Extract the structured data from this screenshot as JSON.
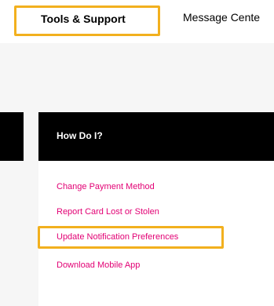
{
  "topbar": {
    "tabs": [
      {
        "label": "Tools & Support",
        "active": true
      },
      {
        "label": "Message Cente",
        "active": false
      }
    ],
    "highlight_color": "#f2b01e"
  },
  "card": {
    "title": "How Do I?",
    "links": [
      {
        "label": "Change Payment Method"
      },
      {
        "label": "Report Card Lost or Stolen"
      },
      {
        "label": "Update Notification Preferences",
        "highlighted": true
      },
      {
        "label": "Download Mobile App"
      }
    ],
    "link_color": "#e20074"
  }
}
